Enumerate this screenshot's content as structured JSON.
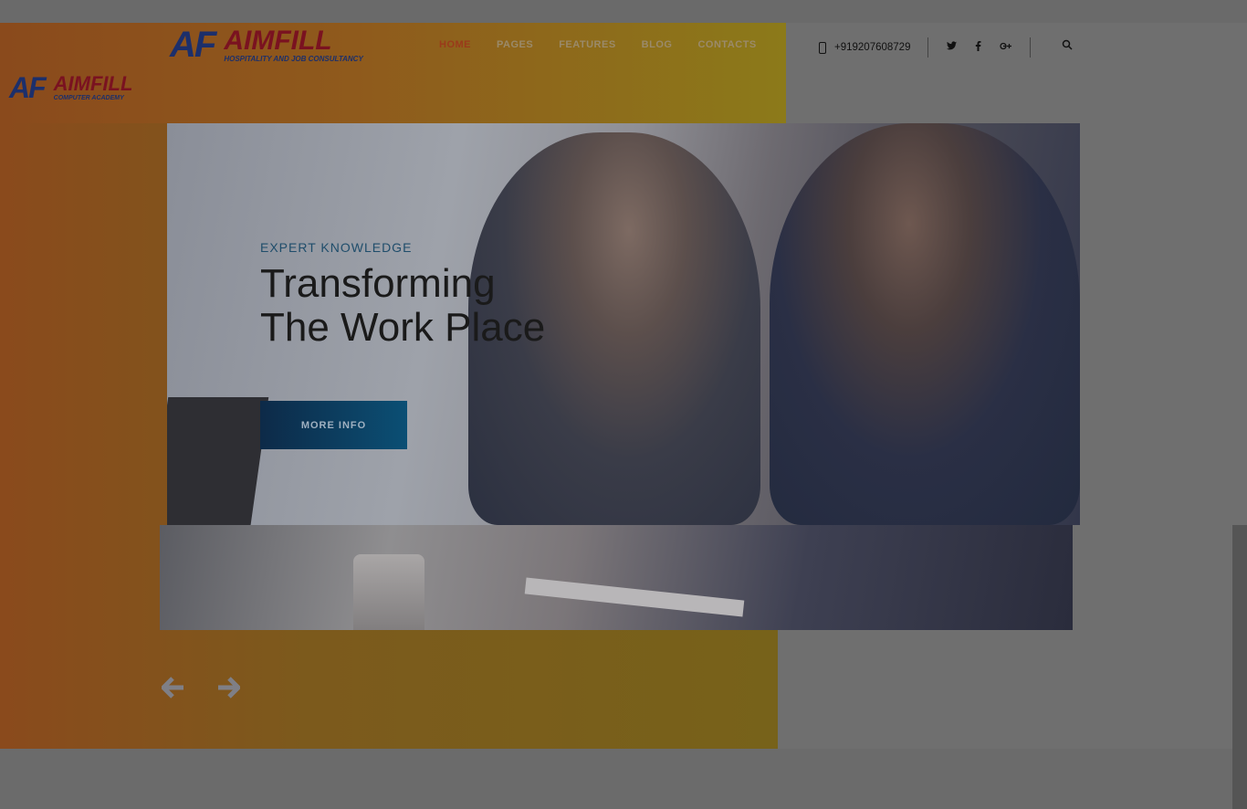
{
  "brand": {
    "main": {
      "mark": "AF",
      "word": "AIMFILL",
      "subtitle": "HOSPITALITY AND JOB CONSULTANCY"
    },
    "secondary": {
      "mark": "AF",
      "word": "AIMFILL",
      "subtitle": "COMPUTER ACADEMY"
    }
  },
  "nav": {
    "items": [
      {
        "label": "HOME",
        "active": true
      },
      {
        "label": "PAGES"
      },
      {
        "label": "FEATURES"
      },
      {
        "label": "BLOG"
      },
      {
        "label": "CONTACTS"
      }
    ]
  },
  "header": {
    "phone": "+919207608729",
    "social": [
      "twitter-icon",
      "facebook-icon",
      "google-plus-icon"
    ],
    "search_icon": "search-icon"
  },
  "hero": {
    "eyebrow": "EXPERT KNOWLEDGE",
    "headline_line1": "Transforming",
    "headline_line2": "The Work Place",
    "cta_label": "MORE INFO"
  },
  "slider": {
    "prev_icon": "arrow-left-icon",
    "next_icon": "arrow-right-icon"
  },
  "colors": {
    "overlay": "#6f6f6f",
    "accent_orange": "#8a4a1c",
    "nav_active": "#9a3a1a",
    "cta": "#0b4f74",
    "brand_red": "#7a1220",
    "brand_blue": "#1c2f6b"
  }
}
